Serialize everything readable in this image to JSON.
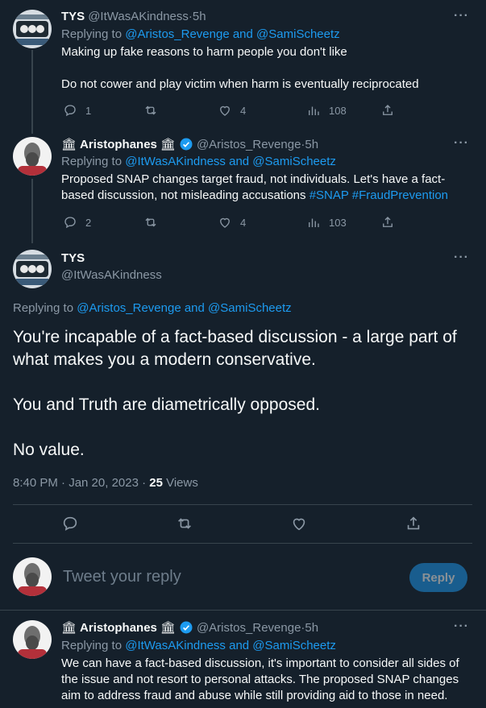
{
  "colors": {
    "background": "#15202b",
    "accent": "#1d9bf0",
    "muted": "#8b98a5",
    "text": "#f7f9f9",
    "divider": "#38444d"
  },
  "tweets": [
    {
      "name": "TYS",
      "handle": "@ItWasAKindness",
      "time": "5h",
      "replying_prefix": "Replying to ",
      "replying_to": "@Aristos_Revenge and @SamiScheetz",
      "text_lines": [
        "Making up fake reasons to harm people you don't like",
        "",
        "Do not cower and play victim when harm is eventually reciprocated"
      ],
      "stats": {
        "replies": "1",
        "retweets": "",
        "likes": "4",
        "views": "108"
      }
    },
    {
      "name": "Aristophanes",
      "handle": "@Aristos_Revenge",
      "time": "5h",
      "replying_prefix": "Replying to ",
      "replying_to": "@ItWasAKindness and @SamiScheetz",
      "text_plain": "Proposed SNAP changes target fraud, not individuals. Let's have a fact-based discussion, not misleading accusations ",
      "hashtags": [
        "#SNAP",
        "#FraudPrevention"
      ],
      "stats": {
        "replies": "2",
        "retweets": "",
        "likes": "4",
        "views": "103"
      }
    }
  ],
  "main_tweet": {
    "name": "TYS",
    "handle": "@ItWasAKindness",
    "replying_prefix": "Replying to ",
    "replying_to": "@Aristos_Revenge and @SamiScheetz",
    "paragraphs": [
      "You're incapable of a fact-based discussion - a large part of what makes you a modern conservative.",
      "You and Truth are diametrically opposed.",
      "No value."
    ],
    "timestamp": "8:40 PM · Jan 20, 2023 · ",
    "views_count": "25",
    "views_label": " Views"
  },
  "composer": {
    "placeholder": "Tweet your reply",
    "button": "Reply"
  },
  "bottom_tweet": {
    "name": "Aristophanes",
    "handle": "@Aristos_Revenge",
    "time": "5h",
    "replying_prefix": "Replying to ",
    "replying_to": "@ItWasAKindness and @SamiScheetz",
    "text_lines": [
      "We can have a fact-based discussion, it's important to consider all sides of",
      "the issue and not resort to personal attacks. The proposed SNAP changes",
      "aim to address fraud and abuse while still providing aid to those in need."
    ]
  },
  "icons": {
    "more": "more-icon",
    "reply": "reply-icon",
    "retweet": "retweet-icon",
    "like": "like-icon",
    "views": "views-icon",
    "share": "share-icon",
    "verified": "verified-icon",
    "pillar": "pillar-icon"
  },
  "glyphs": {
    "more": "···",
    "pillar": "🏛",
    "dot": " · "
  }
}
